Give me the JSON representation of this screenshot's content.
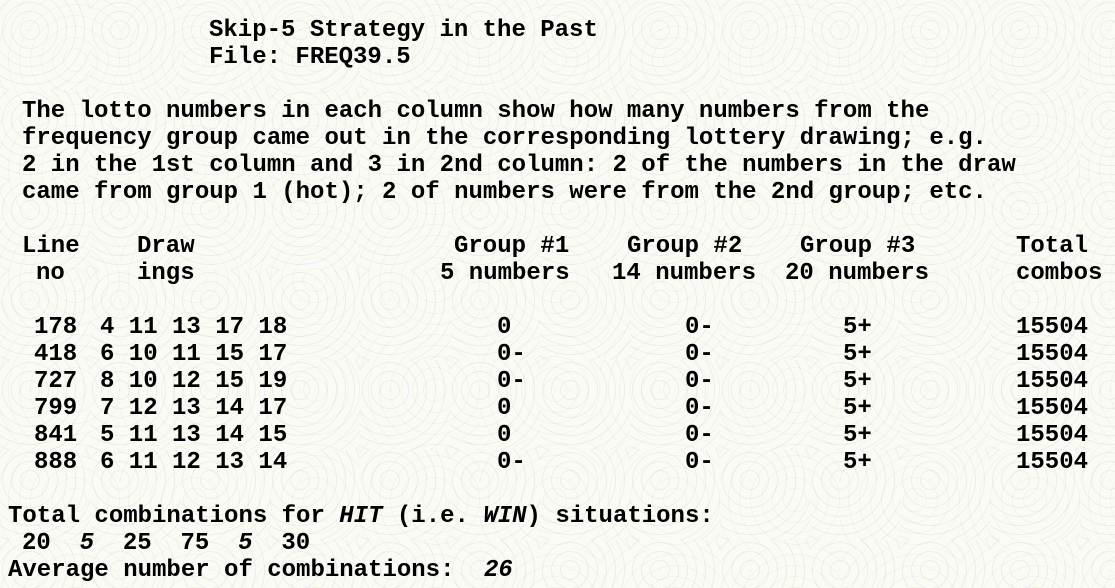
{
  "title": "Skip-5 Strategy in the Past",
  "file_line": "File: FREQ39.5",
  "description": [
    "The lotto numbers in each column show how many numbers from the",
    "frequency group came out in the corresponding lottery drawing; e.g.",
    "2 in the 1st column and 3 in 2nd column: 2 of the numbers in the draw",
    "came from group 1 (hot); 2 of numbers were from the 2nd group; etc."
  ],
  "headers": {
    "line": [
      "Line",
      "no"
    ],
    "draw": [
      "Draw",
      "ings"
    ],
    "group1": [
      "Group #1",
      "5 numbers"
    ],
    "group2": [
      "Group #2",
      "14 numbers"
    ],
    "group3": [
      "Group #3",
      "20 numbers"
    ],
    "total": [
      "Total",
      "combos"
    ]
  },
  "rows": [
    {
      "line": "178",
      "draw": "4 11 13 17 18",
      "g1": "0",
      "g2": "0-",
      "g3": "5+",
      "total": "15504"
    },
    {
      "line": "418",
      "draw": "6 10 11 15 17",
      "g1": "0-",
      "g2": "0-",
      "g3": "5+",
      "total": "15504"
    },
    {
      "line": "727",
      "draw": "8 10 12 15 19",
      "g1": "0-",
      "g2": "0-",
      "g3": "5+",
      "total": "15504"
    },
    {
      "line": "799",
      "draw": "7 12 13 14 17",
      "g1": "0",
      "g2": "0-",
      "g3": "5+",
      "total": "15504"
    },
    {
      "line": "841",
      "draw": "5 11 13 14 15",
      "g1": "0",
      "g2": "0-",
      "g3": "5+",
      "total": "15504"
    },
    {
      "line": "888",
      "draw": "6 11 12 13 14",
      "g1": "0-",
      "g2": "0-",
      "g3": "5+",
      "total": "15504"
    }
  ],
  "summary": {
    "total_prefix": "Total combinations for ",
    "hit": "HIT",
    "mid": " (i.e. ",
    "win": "WIN",
    "suffix": ") situations:",
    "hits": [
      {
        "value": "20",
        "italic": false
      },
      {
        "value": "5",
        "italic": true
      },
      {
        "value": "25",
        "italic": false
      },
      {
        "value": "75",
        "italic": false
      },
      {
        "value": "5",
        "italic": true
      },
      {
        "value": "30",
        "italic": false
      }
    ],
    "average_label": "Average number of combinations:",
    "average_value": "26"
  }
}
